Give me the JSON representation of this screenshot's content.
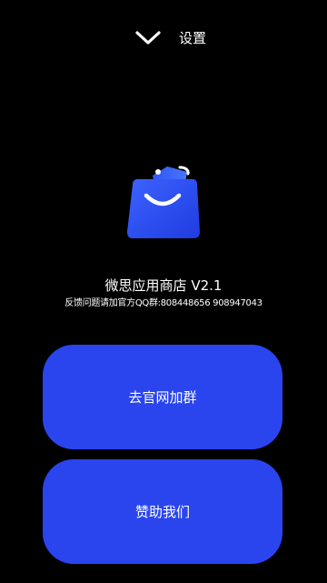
{
  "header": {
    "back_icon": "chevron-down-icon",
    "title": "设置"
  },
  "app": {
    "icon": "shopping-bag-icon",
    "name_version": "微思应用商店 V2.1",
    "feedback_text": "反馈问题请加官方QQ群:808448656 908947043"
  },
  "buttons": {
    "website_label": "去官网加群",
    "donate_label": "赞助我们"
  },
  "colors": {
    "background": "#000000",
    "accent": "#2a45ee",
    "text": "#ffffff"
  }
}
